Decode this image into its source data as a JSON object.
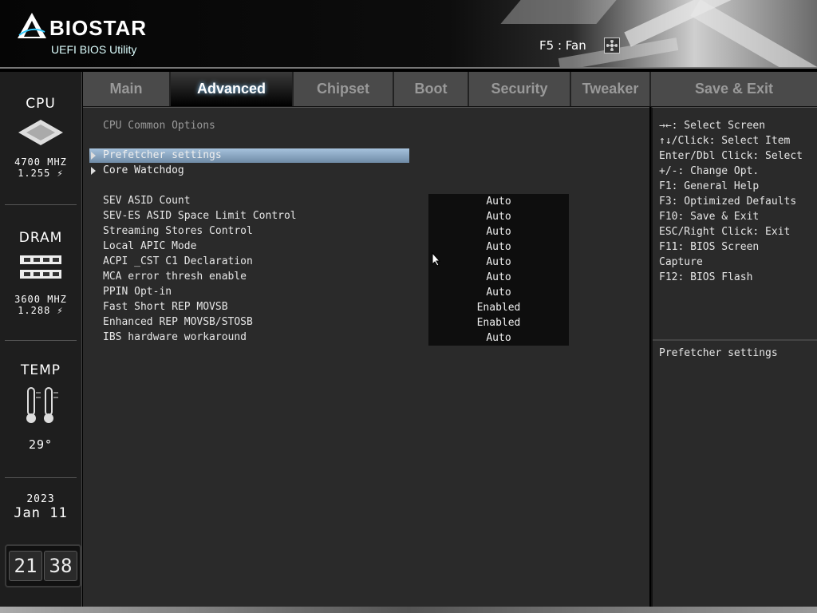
{
  "header": {
    "brand": "BIOSTAR",
    "subtitle": "UEFI BIOS Utility",
    "fan_hint": "F5 : Fan"
  },
  "sidebar": {
    "cpu": {
      "title": "CPU",
      "freq": "4700 MHZ",
      "volt": "1.255 ⚡"
    },
    "dram": {
      "title": "DRAM",
      "freq": "3600 MHZ",
      "volt": "1.288 ⚡"
    },
    "temp": {
      "title": "TEMP",
      "value": "29°"
    },
    "date": {
      "year": "2023",
      "month_day": "Jan 11"
    },
    "clock": {
      "hour": "21",
      "minute": "38"
    }
  },
  "tabs": [
    {
      "label": "Main"
    },
    {
      "label": "Advanced"
    },
    {
      "label": "Chipset"
    },
    {
      "label": "Boot"
    },
    {
      "label": "Security"
    },
    {
      "label": "Tweaker"
    },
    {
      "label": "Save & Exit"
    }
  ],
  "main": {
    "section_title": "CPU Common Options",
    "submenus": [
      {
        "label": "Prefetcher settings"
      },
      {
        "label": "Core Watchdog"
      }
    ],
    "settings": [
      {
        "label": "SEV ASID Count",
        "value": "Auto"
      },
      {
        "label": "SEV-ES ASID Space Limit Control",
        "value": "Auto"
      },
      {
        "label": "Streaming Stores Control",
        "value": "Auto"
      },
      {
        "label": "Local APIC Mode",
        "value": "Auto"
      },
      {
        "label": "ACPI _CST C1 Declaration",
        "value": "Auto"
      },
      {
        "label": "MCA error thresh enable",
        "value": "Auto"
      },
      {
        "label": "PPIN Opt-in",
        "value": "Auto"
      },
      {
        "label": "Fast Short REP MOVSB",
        "value": "Enabled"
      },
      {
        "label": "Enhanced REP MOVSB/STOSB",
        "value": "Enabled"
      },
      {
        "label": "IBS hardware workaround",
        "value": "Auto"
      }
    ]
  },
  "help": {
    "keys": [
      "→←: Select Screen",
      "↑↓/Click: Select Item",
      "Enter/Dbl Click: Select",
      "+/-: Change Opt.",
      "F1: General Help",
      "F3: Optimized Defaults",
      "F10: Save & Exit",
      "ESC/Right Click: Exit",
      "F11: BIOS Screen",
      "Capture",
      "F12: BIOS Flash"
    ],
    "description": "Prefetcher settings"
  }
}
